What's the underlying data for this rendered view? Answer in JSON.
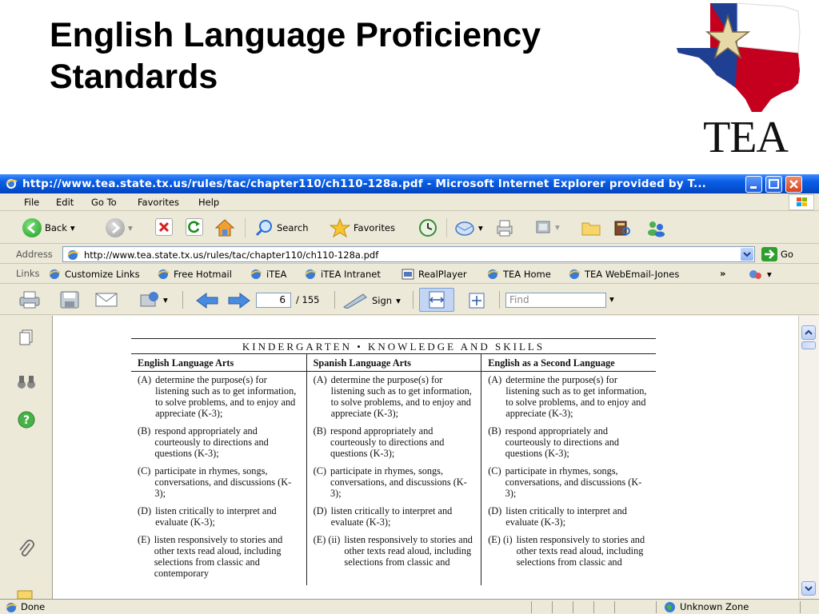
{
  "slide": {
    "title_line1": "English Language Proficiency",
    "title_line2": "Standards",
    "logo_text": "TEA"
  },
  "browser": {
    "title": "http://www.tea.state.tx.us/rules/tac/chapter110/ch110-128a.pdf - Microsoft Internet Explorer provided by T...",
    "menu": [
      "File",
      "Edit",
      "Go To",
      "Favorites",
      "Help"
    ],
    "toolbar": {
      "back_label": "Back",
      "search_label": "Search",
      "favorites_label": "Favorites"
    },
    "address": {
      "label": "Address",
      "url": "http://www.tea.state.tx.us/rules/tac/chapter110/ch110-128a.pdf",
      "go_label": "Go"
    },
    "links": {
      "label": "Links",
      "items": [
        "Customize Links",
        "Free Hotmail",
        "iTEA",
        "iTEA Intranet",
        "RealPlayer",
        "TEA Home",
        "TEA WebEmail-Jones"
      ],
      "more": "»"
    },
    "acrobat": {
      "page_current": "6",
      "page_total": "/ 155",
      "sign_label": "Sign",
      "find_placeholder": "Find"
    },
    "status": {
      "left": "Done",
      "zone": "Unknown Zone"
    }
  },
  "pdf": {
    "heading": "KINDERGARTEN • KNOWLEDGE AND SKILLS",
    "columns": [
      "English Language Arts",
      "Spanish Language Arts",
      "English as a Second Language"
    ],
    "rows": [
      [
        {
          "label": "(A)",
          "text": "determine the purpose(s) for listening such as to get information, to solve problems, and to enjoy and appreciate (K-3);"
        },
        {
          "label": "(B)",
          "text": "respond appropriately and courteously to directions and questions (K-3);"
        },
        {
          "label": "(C)",
          "text": "participate in rhymes, songs, conversations, and discussions (K-3);"
        },
        {
          "label": "(D)",
          "text": "listen critically to interpret and evaluate (K-3);"
        },
        {
          "label": "(E)",
          "text": "listen responsively to stories and other texts read aloud, including selections from classic and contemporary"
        }
      ],
      [
        {
          "label": "(A)",
          "text": "determine the purpose(s) for listening such as to get information, to solve problems, and to enjoy and appreciate (K-3);"
        },
        {
          "label": "(B)",
          "text": "respond appropriately and courteously to directions and questions (K-3);"
        },
        {
          "label": "(C)",
          "text": "participate in rhymes, songs, conversations, and discussions (K-3);"
        },
        {
          "label": "(D)",
          "text": "listen critically to interpret and evaluate (K-3);"
        },
        {
          "label": "(E) (ii)",
          "text": "listen responsively to stories and other texts read aloud, including selections from classic and"
        }
      ],
      [
        {
          "label": "(A)",
          "text": "determine the purpose(s) for listening such as to get information, to solve problems, and to enjoy and appreciate (K-3);"
        },
        {
          "label": "(B)",
          "text": "respond appropriately and courteously to directions and questions (K-3);"
        },
        {
          "label": "(C)",
          "text": "participate in rhymes, songs, conversations, and discussions (K-3);"
        },
        {
          "label": "(D)",
          "text": "listen critically to interpret and evaluate (K-3);"
        },
        {
          "label": "(E) (i)",
          "text": "listen responsively to stories and other texts read aloud, including selections from classic and"
        }
      ]
    ]
  },
  "colors": {
    "titlebar": "#0a5de3",
    "chrome": "#ece9d8",
    "texas_blue": "#1f3f93",
    "texas_red": "#c4001e"
  }
}
